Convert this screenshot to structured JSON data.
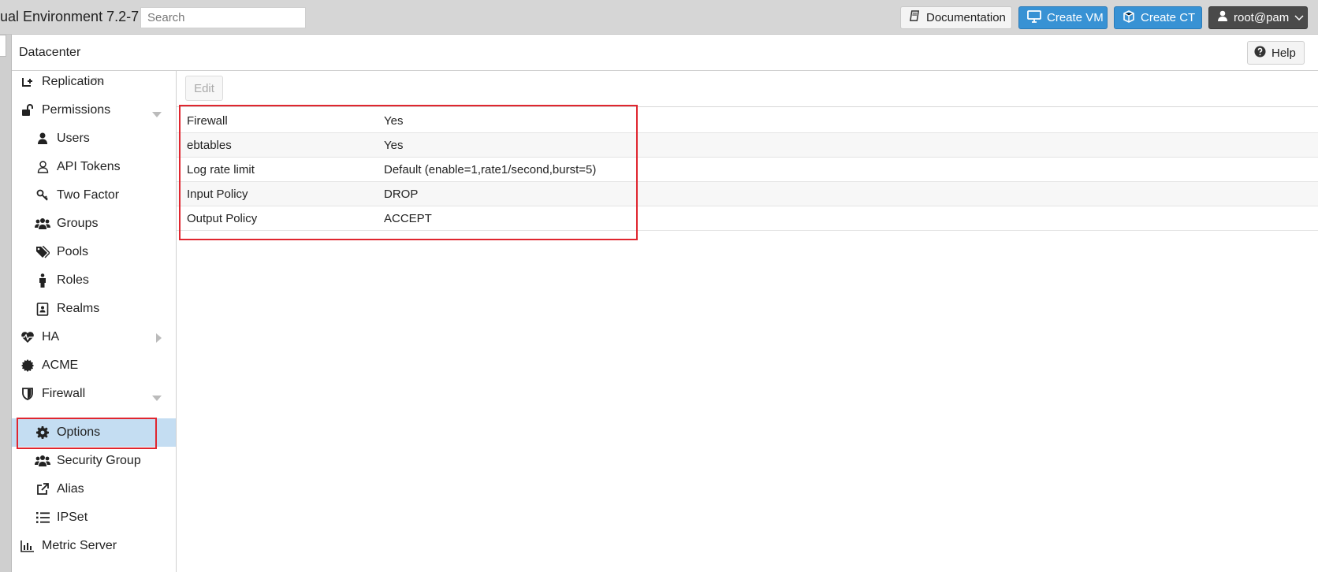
{
  "topbar": {
    "app_title": "ual Environment 7.2-7",
    "search_placeholder": "Search",
    "documentation_label": "Documentation",
    "create_vm_label": "Create VM",
    "create_ct_label": "Create CT",
    "user_label": "root@pam"
  },
  "header": {
    "title": "Datacenter",
    "help_label": "Help"
  },
  "sidebar": {
    "items": [
      {
        "label": "Replication",
        "icon": "replication-icon"
      },
      {
        "label": "Permissions",
        "icon": "unlock-icon"
      },
      {
        "label": "Users",
        "icon": "user-icon"
      },
      {
        "label": "API Tokens",
        "icon": "user-outline-icon"
      },
      {
        "label": "Two Factor",
        "icon": "key-icon"
      },
      {
        "label": "Groups",
        "icon": "users-icon"
      },
      {
        "label": "Pools",
        "icon": "tags-icon"
      },
      {
        "label": "Roles",
        "icon": "male-icon"
      },
      {
        "label": "Realms",
        "icon": "address-book-icon"
      },
      {
        "label": "HA",
        "icon": "heartbeat-icon"
      },
      {
        "label": "ACME",
        "icon": "certificate-icon"
      },
      {
        "label": "Firewall",
        "icon": "shield-icon"
      },
      {
        "label": "Options",
        "icon": "gear-icon"
      },
      {
        "label": "Security Group",
        "icon": "users-icon"
      },
      {
        "label": "Alias",
        "icon": "external-link-icon"
      },
      {
        "label": "IPSet",
        "icon": "list-icon"
      },
      {
        "label": "Metric Server",
        "icon": "bar-chart-icon"
      }
    ]
  },
  "main": {
    "edit_label": "Edit",
    "rows": [
      {
        "key": "Firewall",
        "value": "Yes"
      },
      {
        "key": "ebtables",
        "value": "Yes"
      },
      {
        "key": "Log rate limit",
        "value": "Default (enable=1,rate1/second,burst=5)"
      },
      {
        "key": "Input Policy",
        "value": "DROP"
      },
      {
        "key": "Output Policy",
        "value": "ACCEPT"
      }
    ]
  },
  "colors": {
    "accent_blue": "#3892d4",
    "selected_bg": "#c4ddf2",
    "highlight_red": "#e0262f",
    "user_button": "#4a4a4a"
  }
}
